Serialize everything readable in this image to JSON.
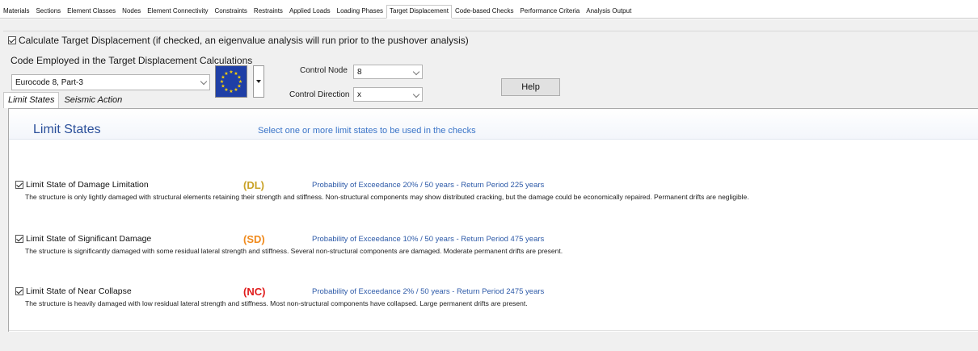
{
  "top_tabs": [
    {
      "label": "Materials",
      "active": false
    },
    {
      "label": "Sections",
      "active": false
    },
    {
      "label": "Element Classes",
      "active": false
    },
    {
      "label": "Nodes",
      "active": false
    },
    {
      "label": "Element Connectivity",
      "active": false
    },
    {
      "label": "Constraints",
      "active": false
    },
    {
      "label": "Restraints",
      "active": false
    },
    {
      "label": "Applied Loads",
      "active": false
    },
    {
      "label": "Loading Phases",
      "active": false
    },
    {
      "label": "Target Displacement",
      "active": true
    },
    {
      "label": "Code-based Checks",
      "active": false
    },
    {
      "label": "Performance Criteria",
      "active": false
    },
    {
      "label": "Analysis Output",
      "active": false
    }
  ],
  "calc_target": {
    "checked": true,
    "label": "Calculate Target Displacement (if checked, an eigenvalue analysis will run prior to the pushover analysis)"
  },
  "code_section": {
    "label": "Code Employed in the Target Displacement Calculations",
    "selected_code": "Eurocode 8, Part-3",
    "flag_icon": "eu-flag-icon"
  },
  "control": {
    "node_label": "Control Node",
    "node_value": "8",
    "direction_label": "Control Direction",
    "direction_value": "x"
  },
  "help_label": "Help",
  "inner_tabs": [
    {
      "label": "Limit States",
      "active": true
    },
    {
      "label": "Seismic Action",
      "active": false
    }
  ],
  "limit_states": {
    "title": "Limit States",
    "subtitle": "Select one or more limit states to be used in the checks",
    "items": [
      {
        "checked": true,
        "name": "Limit State of Damage Limitation",
        "code": "(DL)",
        "color": "#c9a227",
        "probability": "Probability of Exceedance 20% / 50 years - Return Period 225 years",
        "description": "The structure is only lightly damaged with structural elements retaining their strength and stiffness. Non-structural components may show distributed cracking, but the damage could be economically repaired. Permanent drifts are negligible."
      },
      {
        "checked": true,
        "name": "Limit State of Significant Damage",
        "code": "(SD)",
        "color": "#f08a1c",
        "probability": "Probability of Exceedance 10% / 50 years - Return Period 475 years",
        "description": "The structure is significantly damaged with some residual lateral strength and stiffness. Several non-structural components are damaged. Moderate permanent drifts are present."
      },
      {
        "checked": true,
        "name": "Limit State of Near Collapse",
        "code": "(NC)",
        "color": "#e01b1b",
        "probability": "Probability of Exceedance 2% / 50 years - Return Period 2475 years",
        "description": "The structure is heavily damaged with low residual lateral strength and stiffness. Most non-structural components have collapsed. Large permanent drifts are present."
      }
    ]
  }
}
